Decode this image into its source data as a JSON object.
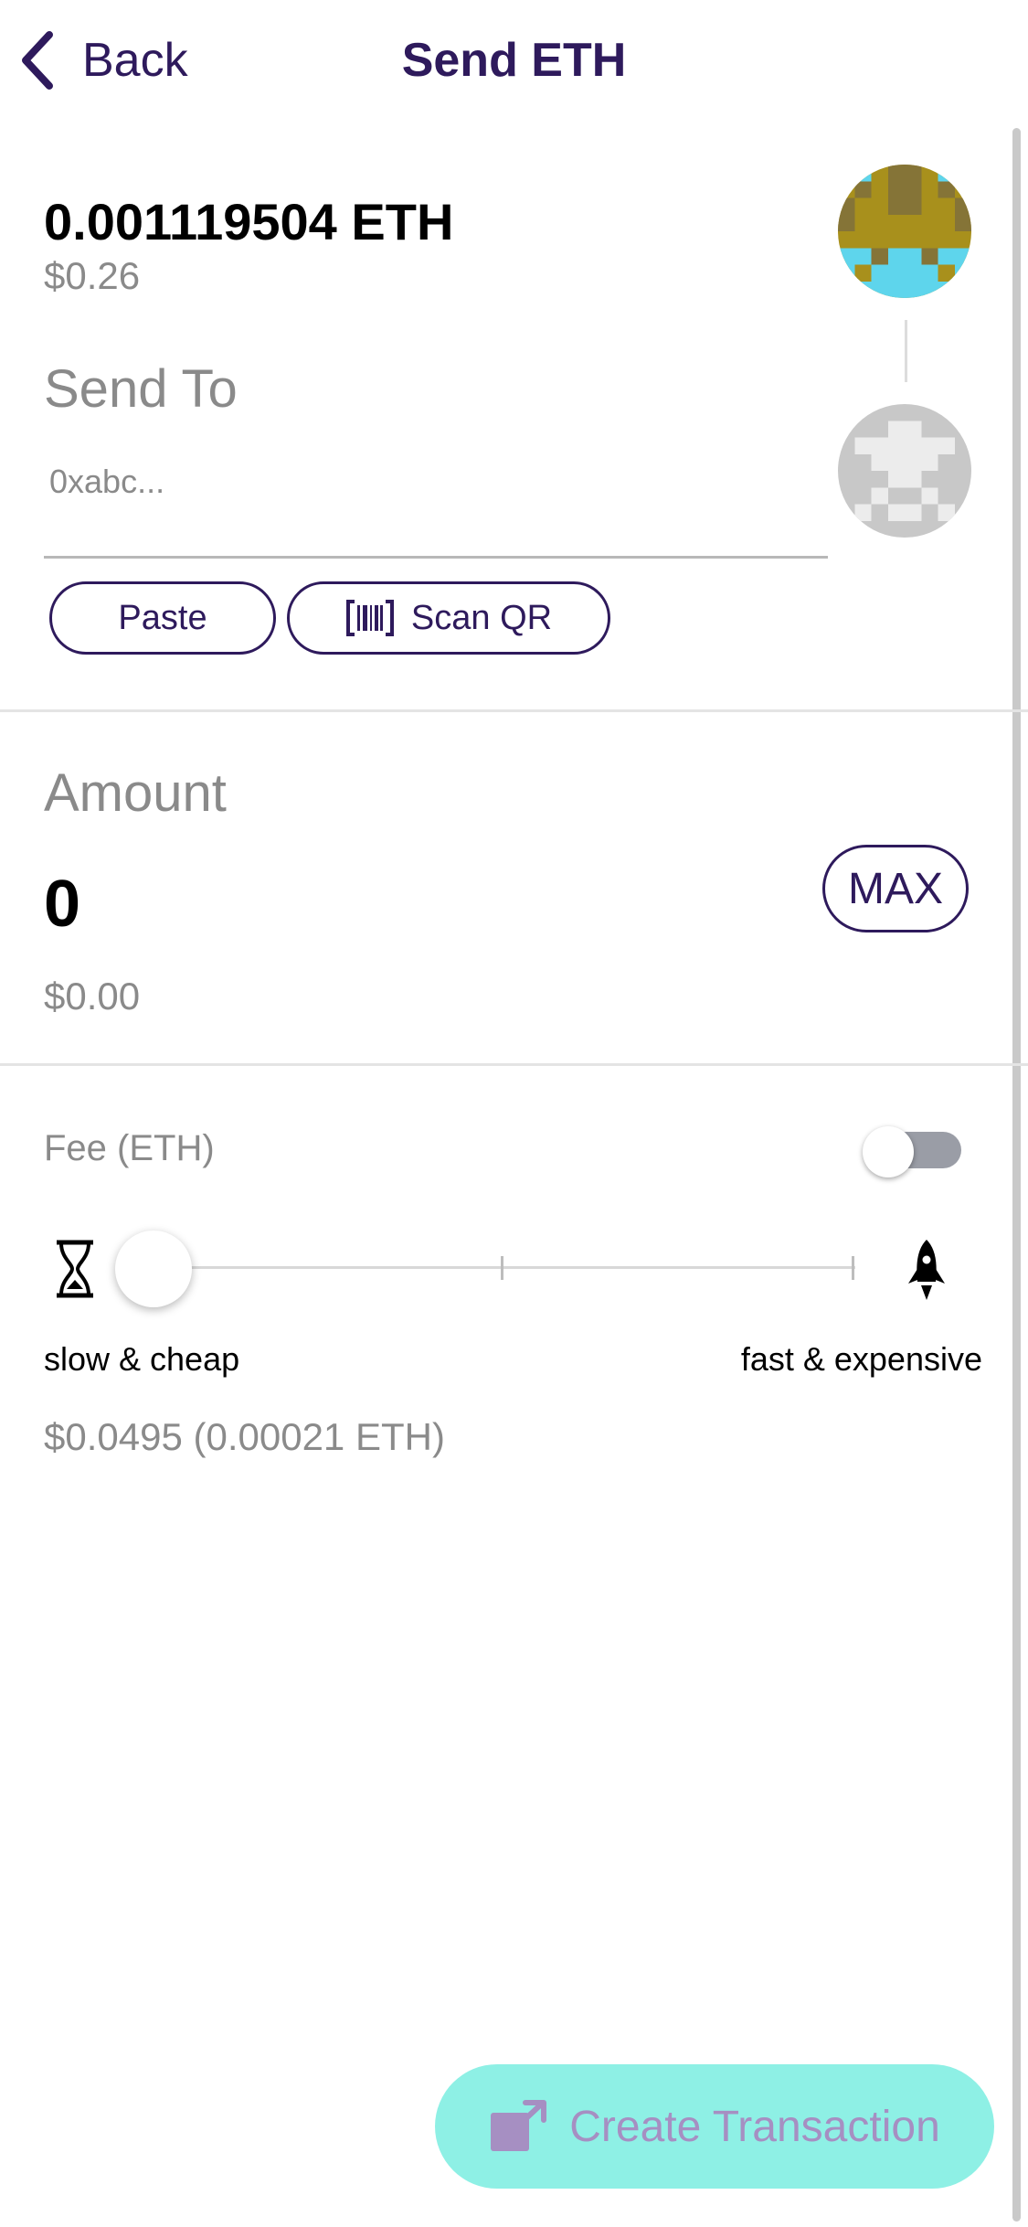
{
  "nav": {
    "back_label": "Back",
    "title": "Send ETH"
  },
  "balance": {
    "amount": "0.001119504 ETH",
    "fiat": "$0.26"
  },
  "send_to": {
    "label": "Send To",
    "address_placeholder": "0xabc...",
    "paste_label": "Paste",
    "scan_label": "Scan QR"
  },
  "amount": {
    "label": "Amount",
    "value": "0",
    "fiat": "$0.00",
    "max_label": "MAX"
  },
  "fee": {
    "label": "Fee (ETH)",
    "toggle_on": false,
    "slow_label": "slow & cheap",
    "fast_label": "fast & expensive",
    "value": "$0.0495 (0.00021 ETH)",
    "slider_level": 0
  },
  "create_button": {
    "label": "Create Transaction"
  },
  "icons": {
    "back": "chevron-left-icon",
    "scan": "barcode-icon",
    "slow": "hourglass-icon",
    "fast": "rocket-icon",
    "create": "external-link-icon"
  },
  "colors": {
    "brand": "#2e1a5c",
    "muted_text": "#8a8a8a",
    "create_button_bg": "#8ef0e5",
    "create_button_text": "#a68fc2",
    "sender_avatar_gold": "#a8901c",
    "sender_avatar_dark": "#857437",
    "sender_avatar_cyan": "#5ed5ec",
    "recipient_avatar_gray": "#c8c8c8"
  }
}
